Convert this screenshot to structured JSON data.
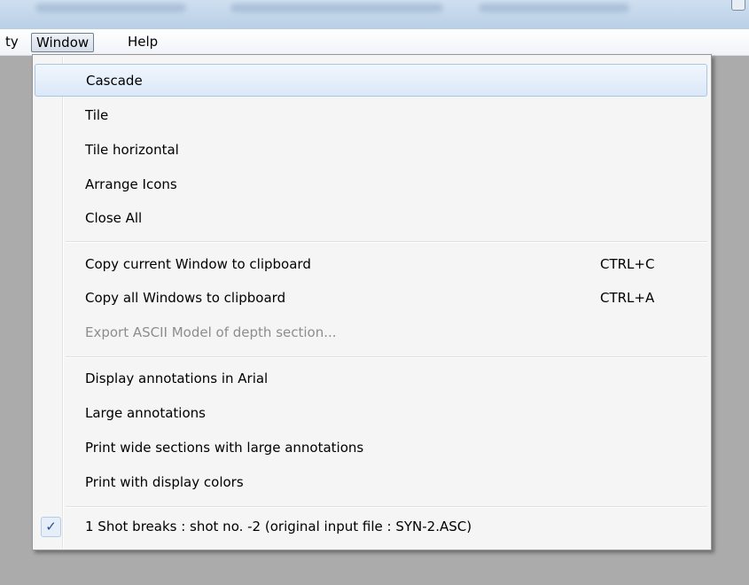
{
  "menubar": {
    "items": [
      {
        "label": "ty"
      },
      {
        "label": "Window"
      },
      {
        "label": "Help"
      }
    ]
  },
  "menu": {
    "items": [
      {
        "label": "Cascade",
        "shortcut": ""
      },
      {
        "label": "Tile",
        "shortcut": ""
      },
      {
        "label": "Tile horizontal",
        "shortcut": ""
      },
      {
        "label": "Arrange Icons",
        "shortcut": ""
      },
      {
        "label": "Close All",
        "shortcut": ""
      },
      {
        "label": "Copy current Window to clipboard",
        "shortcut": "CTRL+C"
      },
      {
        "label": "Copy all Windows to clipboard",
        "shortcut": "CTRL+A"
      },
      {
        "label": "Export ASCII Model of depth section...",
        "shortcut": "",
        "disabled": true
      },
      {
        "label": "Display annotations in Arial",
        "shortcut": ""
      },
      {
        "label": "Large annotations",
        "shortcut": ""
      },
      {
        "label": "Print wide sections with large annotations",
        "shortcut": ""
      },
      {
        "label": "Print with display colors",
        "shortcut": ""
      },
      {
        "label": "1 Shot breaks : shot no. -2 (original input file : SYN-2.ASC)",
        "shortcut": "",
        "checked": true
      }
    ],
    "check_glyph": "✓"
  }
}
